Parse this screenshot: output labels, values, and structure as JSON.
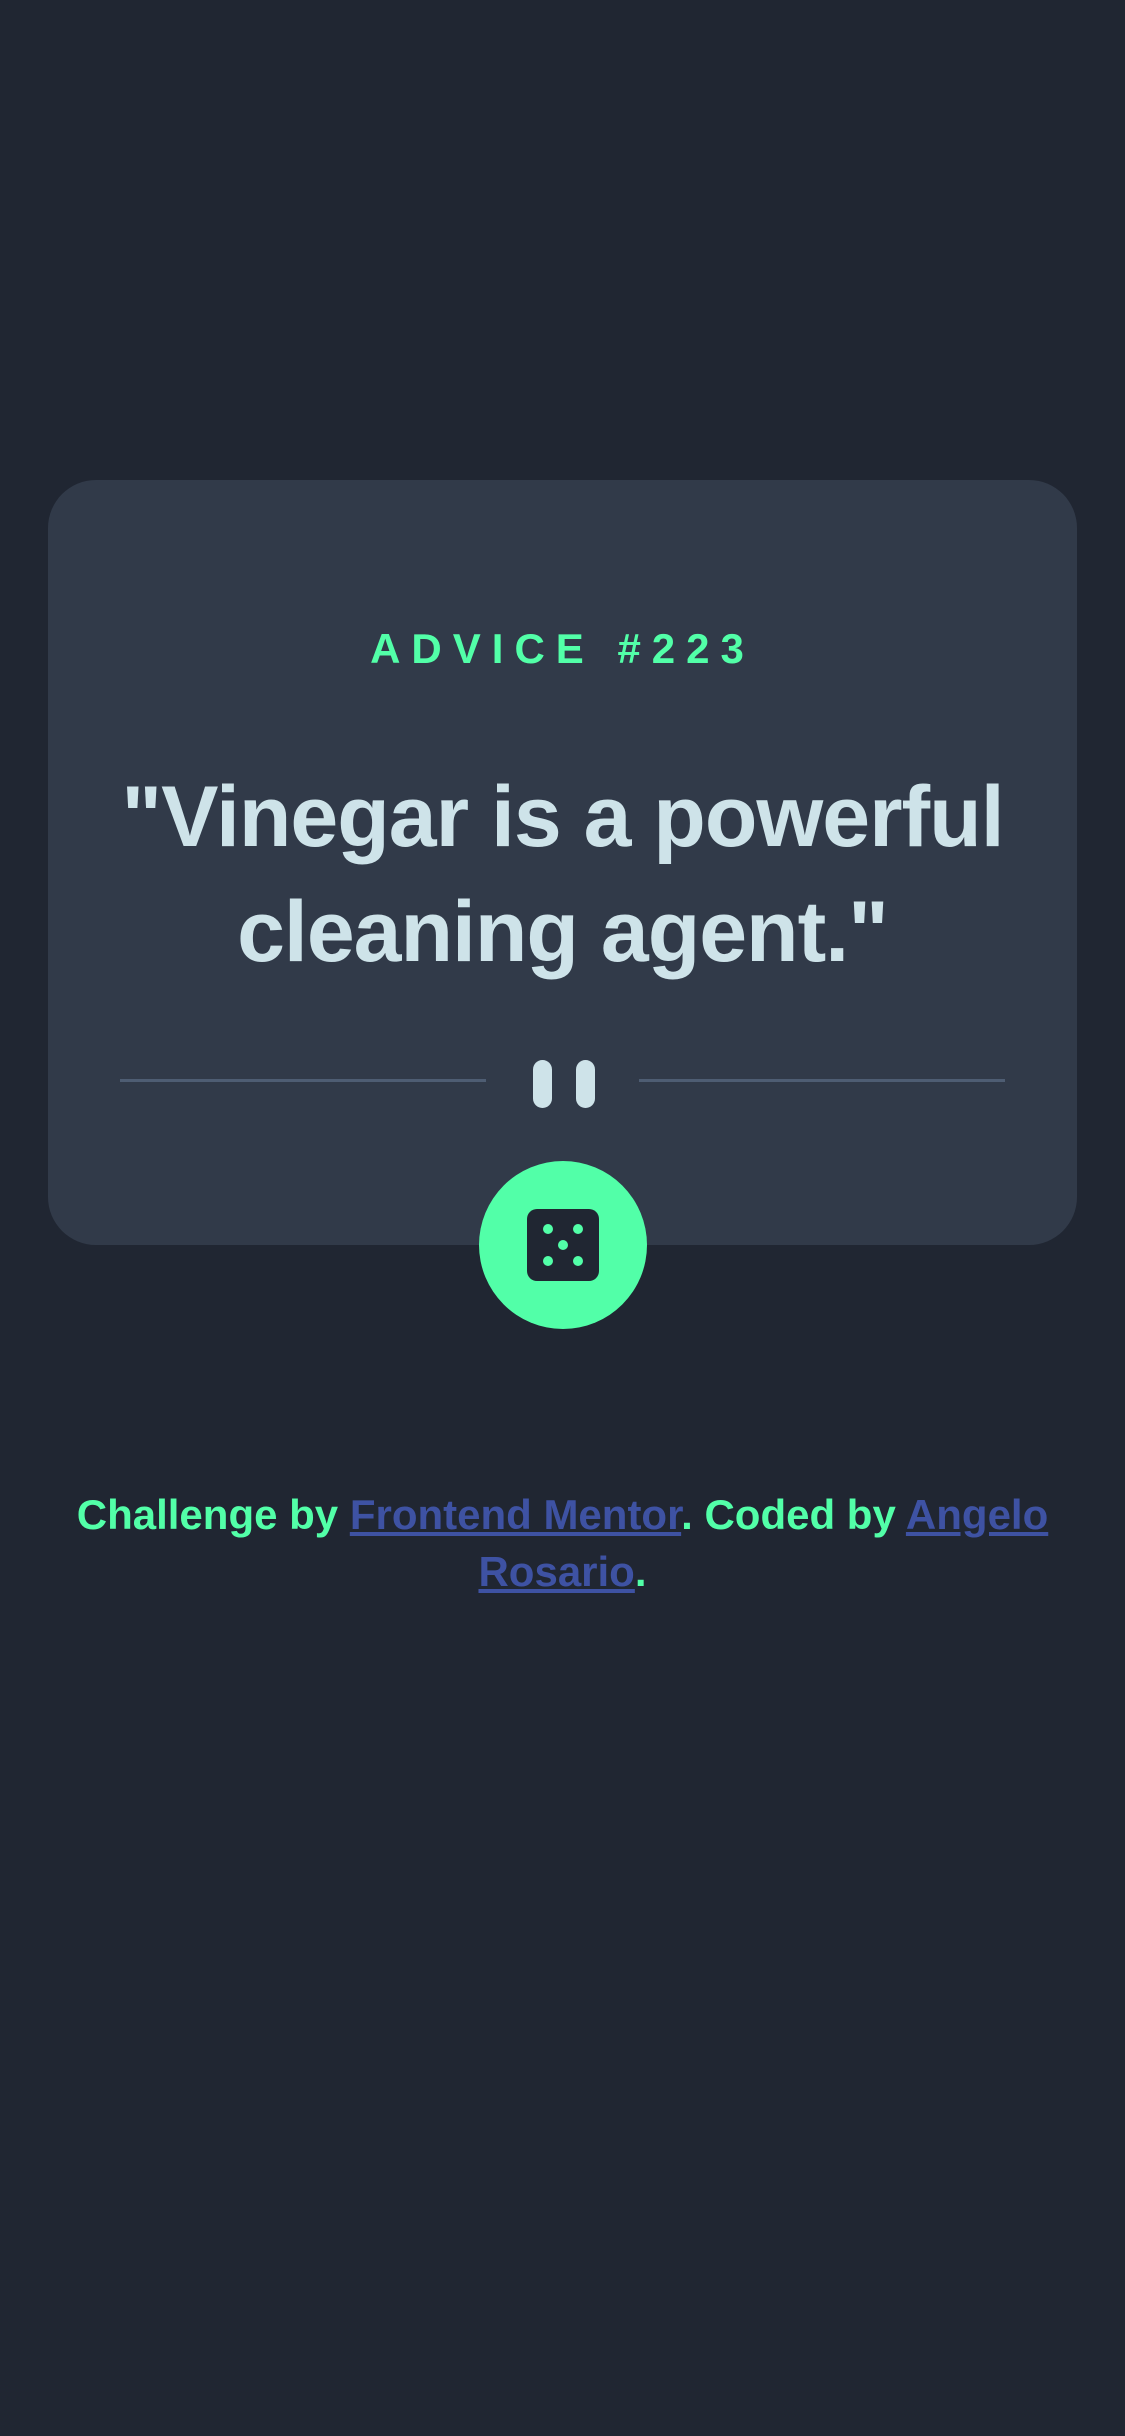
{
  "card": {
    "advice_label": "ADVICE #223",
    "advice_text": "\"Vinegar is a powerful cleaning agent.\""
  },
  "actions": {
    "dice_icon": "dice-five-icon"
  },
  "footer": {
    "challenge_prefix": "Challenge by ",
    "challenge_link": "Frontend Mentor",
    "coded_prefix": ". Coded by ",
    "coded_link": "Angelo Rosario",
    "suffix": "."
  },
  "colors": {
    "background": "#202632",
    "card": "#313A49",
    "accent": "#52FFA8",
    "text": "#CEE3E9",
    "link": "#3E52A3",
    "divider": "#4E5D73"
  }
}
